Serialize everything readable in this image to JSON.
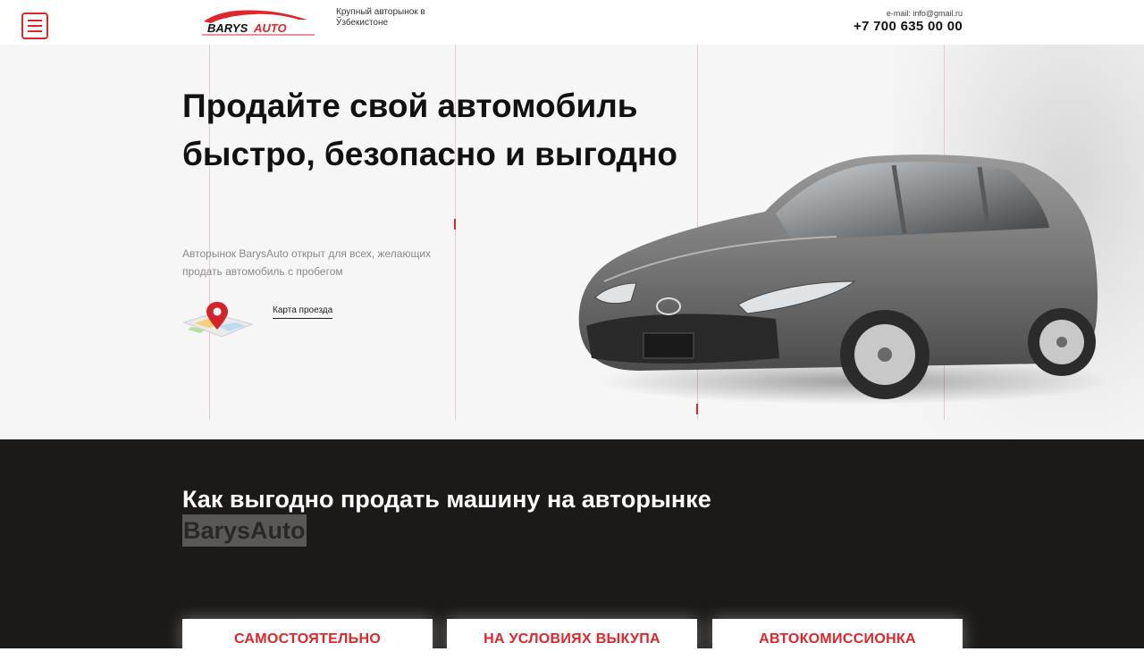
{
  "header": {
    "logo_text": "BARYSAUTO",
    "tagline": "Крупный авторынок в Ўзбекистоне",
    "email": "e-mail: info@gmail.ru",
    "phone": "+7 700 635 00 00"
  },
  "hero": {
    "title": "Продайте свой автомобиль быстро, безопасно и выгодно",
    "subtitle": "Авторынок BarysAuto открыт для всех, желающих продать автомобиль с пробегом",
    "map_link": "Карта проезда"
  },
  "section": {
    "title": "Как выгодно продать машину на авторынке",
    "brand": "BarysAuto",
    "cards": [
      {
        "label": "САМОСТОЯТЕЛЬНО"
      },
      {
        "label": "НА УСЛОВИЯХ ВЫКУПА"
      },
      {
        "label": "АВТОКОМИССИОНКА"
      }
    ]
  },
  "colors": {
    "accent": "#e0262b",
    "dark_bg": "#1c1a18",
    "hero_bg": "#f6f6f6"
  }
}
